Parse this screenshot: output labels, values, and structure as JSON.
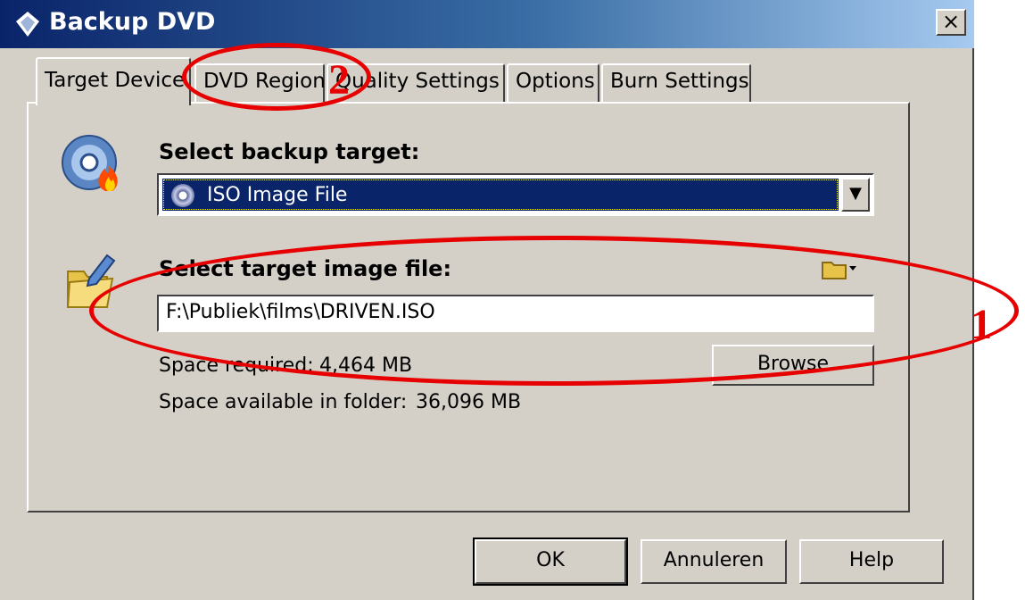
{
  "window": {
    "title": "Backup DVD",
    "close_label": "×"
  },
  "tabs": [
    {
      "label": "Target Device",
      "active": true
    },
    {
      "label": "DVD Region"
    },
    {
      "label": "Quality Settings"
    },
    {
      "label": "Options"
    },
    {
      "label": "Burn Settings"
    }
  ],
  "target": {
    "heading": "Select backup target:",
    "selected": "ISO Image File",
    "icon": "disc-flame-icon"
  },
  "image_file": {
    "heading": "Select target image file:",
    "path": "F:\\Publiek\\films\\DRIVEN.ISO",
    "icon": "folder-pen-icon",
    "browse_label": "Browse",
    "space_required_label": "Space required:",
    "space_required_value": "4,464 MB",
    "space_available_label": "Space available in folder:",
    "space_available_value": "36,096 MB"
  },
  "footer": {
    "ok_label": "OK",
    "cancel_label": "Annuleren",
    "help_label": "Help"
  },
  "annotations": {
    "one": "1",
    "two": "2",
    "color": "#e60000"
  }
}
